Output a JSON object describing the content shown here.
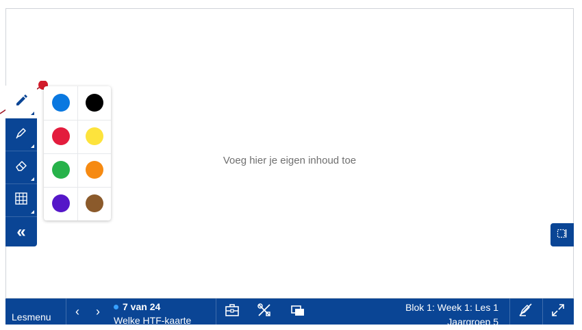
{
  "canvas": {
    "placeholder": "Voeg hier je eigen inhoud toe"
  },
  "toolrail": {
    "tools": [
      {
        "name": "pen-icon",
        "active": true
      },
      {
        "name": "highlighter-icon",
        "active": false
      },
      {
        "name": "eraser-icon",
        "active": false
      },
      {
        "name": "grid-icon",
        "active": false
      }
    ],
    "collapse_label": "«"
  },
  "palette": {
    "colors": [
      {
        "name": "blue",
        "hex": "#0a78e0"
      },
      {
        "name": "black",
        "hex": "#000000"
      },
      {
        "name": "red",
        "hex": "#e31c3d"
      },
      {
        "name": "yellow",
        "hex": "#fde33c"
      },
      {
        "name": "green",
        "hex": "#27b24a"
      },
      {
        "name": "orange",
        "hex": "#f68a12"
      },
      {
        "name": "purple",
        "hex": "#5517c8"
      },
      {
        "name": "brown",
        "hex": "#8b5a2b"
      }
    ]
  },
  "annotation_color": "#d21b2a",
  "bottombar": {
    "lesmenu_label": "Lesmenu",
    "prev_label": "‹",
    "next_label": "›",
    "slide_count": "7 van 24",
    "slide_title": "Welke HTF-kaarte",
    "lesson_line1": "Blok 1: Week 1: Les 1",
    "lesson_line2": "Jaargroep 5"
  },
  "colors": {
    "brand": "#0a4595",
    "accent_dot": "#37a0ff"
  }
}
